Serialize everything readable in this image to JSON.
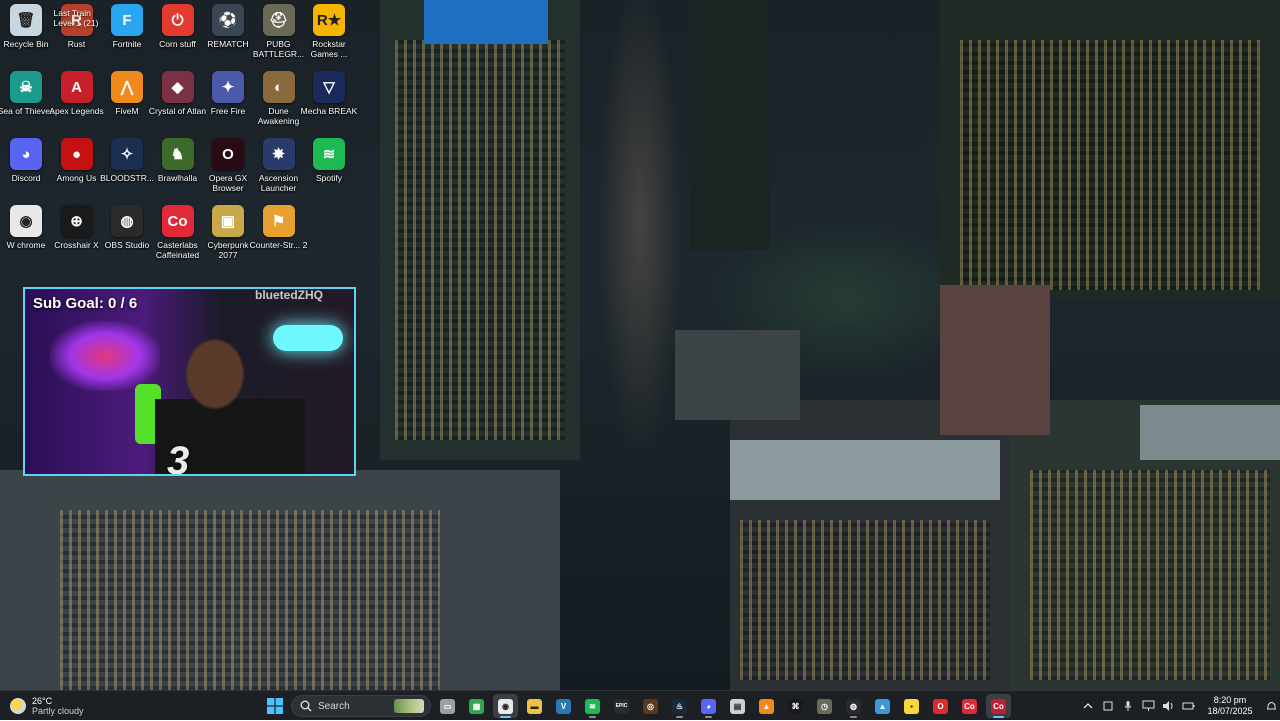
{
  "desktop": {
    "icons": [
      {
        "label": "Recycle Bin",
        "icon": "recycle-bin-icon",
        "color": "#c8d6e0",
        "glyph": "🗑"
      },
      {
        "label": "Rust",
        "icon": "rust-icon",
        "color": "#b7402a",
        "glyph": "R",
        "overlay": "Last Train\nLevel 1 (21)"
      },
      {
        "label": "Fortnite",
        "icon": "fortnite-icon",
        "color": "#2aa6f0",
        "glyph": "F"
      },
      {
        "label": "Corn stuff",
        "icon": "power-icon",
        "color": "#e23a2f",
        "glyph": "⏻"
      },
      {
        "label": "REMATCH",
        "icon": "soccer-ball-icon",
        "color": "#3a4654",
        "glyph": "⚽"
      },
      {
        "label": "PUBG BATTLEGR...",
        "icon": "pubg-helmet-icon",
        "color": "#6b6b55",
        "glyph": "⛑"
      },
      {
        "label": "Rockstar Games ...",
        "icon": "rockstar-icon",
        "color": "#f4b400",
        "glyph": "R★"
      },
      {
        "label": "Sea of Thieves",
        "icon": "skull-icon",
        "color": "#1c9a8c",
        "glyph": "☠"
      },
      {
        "label": "Apex Legends",
        "icon": "apex-icon",
        "color": "#c8202a",
        "glyph": "A"
      },
      {
        "label": "FiveM",
        "icon": "fivem-icon",
        "color": "#f08a1c",
        "glyph": "⋀"
      },
      {
        "label": "Crystal of Atlan",
        "icon": "crystal-of-atlan-icon",
        "color": "#7a3144",
        "glyph": "◆"
      },
      {
        "label": "Free Fire",
        "icon": "free-fire-icon",
        "color": "#4a5aa8",
        "glyph": "✦"
      },
      {
        "label": "Dune Awakening",
        "icon": "dune-icon",
        "color": "#8a6a3a",
        "glyph": "◐"
      },
      {
        "label": "Mecha BREAK",
        "icon": "mecha-break-icon",
        "color": "#1a2a5a",
        "glyph": "▽"
      },
      {
        "label": "Discord",
        "icon": "discord-icon",
        "color": "#5865f2",
        "glyph": "◕"
      },
      {
        "label": "Among Us",
        "icon": "among-us-icon",
        "color": "#c51111",
        "glyph": "●"
      },
      {
        "label": "BLOODSTR...",
        "icon": "bloodstrike-icon",
        "color": "#1b3050",
        "glyph": "✧"
      },
      {
        "label": "Brawlhalla",
        "icon": "brawlhalla-icon",
        "color": "#3d6a2a",
        "glyph": "♞"
      },
      {
        "label": "Opera GX Browser",
        "icon": "opera-gx-icon",
        "color": "#2a0a14",
        "glyph": "O"
      },
      {
        "label": "Ascension Launcher",
        "icon": "ascension-icon",
        "color": "#2a3a6a",
        "glyph": "✸"
      },
      {
        "label": "Spotify",
        "icon": "spotify-icon",
        "color": "#1db954",
        "glyph": "≋"
      },
      {
        "label": "W chrome",
        "icon": "chrome-icon",
        "color": "#e8e8e8",
        "glyph": "◉"
      },
      {
        "label": "Crosshair X",
        "icon": "crosshair-icon",
        "color": "#1a1a1a",
        "glyph": "⊕"
      },
      {
        "label": "OBS Studio",
        "icon": "obs-icon",
        "color": "#2a2a2a",
        "glyph": "◍"
      },
      {
        "label": "Casterlabs Caffeinated",
        "icon": "casterlabs-icon",
        "color": "#e02a3a",
        "glyph": "Co"
      },
      {
        "label": "Cyberpunk 2077",
        "icon": "cyberpunk-icon",
        "color": "#c9a84a",
        "glyph": "▣"
      },
      {
        "label": "Counter-Str... 2",
        "icon": "counter-strike-icon",
        "color": "#e8a030",
        "glyph": "⚑"
      }
    ]
  },
  "overlay": {
    "sub_goal": "Sub Goal:  0 / 6",
    "handle": "bluetedZHQ",
    "logo": "3"
  },
  "taskbar": {
    "weather": {
      "temp": "26°C",
      "desc": "Partly cloudy"
    },
    "search_label": "Search",
    "apps": [
      {
        "name": "task-view-icon",
        "color": "#9aa0a6",
        "glyph": "▭",
        "state": ""
      },
      {
        "name": "xbox-icon",
        "color": "#2da84a",
        "glyph": "▦",
        "state": ""
      },
      {
        "name": "chrome-taskbar-icon",
        "color": "#e8e8e8",
        "glyph": "◉",
        "state": "active"
      },
      {
        "name": "file-explorer-icon",
        "color": "#f0c040",
        "glyph": "▬",
        "state": ""
      },
      {
        "name": "visual-studio-icon",
        "color": "#2a7ab0",
        "glyph": "V",
        "state": ""
      },
      {
        "name": "spotify-taskbar-icon",
        "color": "#1db954",
        "glyph": "≋",
        "state": "run"
      },
      {
        "name": "epic-games-icon",
        "color": "#2b2b2b",
        "glyph": "EPIC",
        "state": ""
      },
      {
        "name": "gog-icon",
        "color": "#5a3a1a",
        "glyph": "◎",
        "state": ""
      },
      {
        "name": "steam-icon",
        "color": "#1b2838",
        "glyph": "♨",
        "state": "run"
      },
      {
        "name": "discord-taskbar-icon",
        "color": "#5865f2",
        "glyph": "◕",
        "state": "run"
      },
      {
        "name": "media-icon",
        "color": "#d0d0d0",
        "glyph": "▤",
        "state": ""
      },
      {
        "name": "vlc-icon",
        "color": "#f08a1c",
        "glyph": "▲",
        "state": ""
      },
      {
        "name": "capcut-icon",
        "color": "#1a1a1a",
        "glyph": "⌘",
        "state": ""
      },
      {
        "name": "clock-app-icon",
        "color": "#6a6a5a",
        "glyph": "◷",
        "state": ""
      },
      {
        "name": "obs-taskbar-icon",
        "color": "#2a2a2a",
        "glyph": "◍",
        "state": "run"
      },
      {
        "name": "photos-icon",
        "color": "#3a9ad8",
        "glyph": "▲",
        "state": ""
      },
      {
        "name": "sticky-notes-icon",
        "color": "#f8d838",
        "glyph": "▪",
        "state": ""
      },
      {
        "name": "opera-taskbar-icon",
        "color": "#e02a2a",
        "glyph": "O",
        "state": ""
      },
      {
        "name": "casterlabs-taskbar-icon",
        "color": "#e02a3a",
        "glyph": "Co",
        "state": ""
      },
      {
        "name": "casterlabs-alt-taskbar-icon",
        "color": "#c02030",
        "glyph": "Co",
        "state": "active"
      }
    ],
    "clock": {
      "time": "8:20 pm",
      "date": "18/07/2025"
    }
  }
}
